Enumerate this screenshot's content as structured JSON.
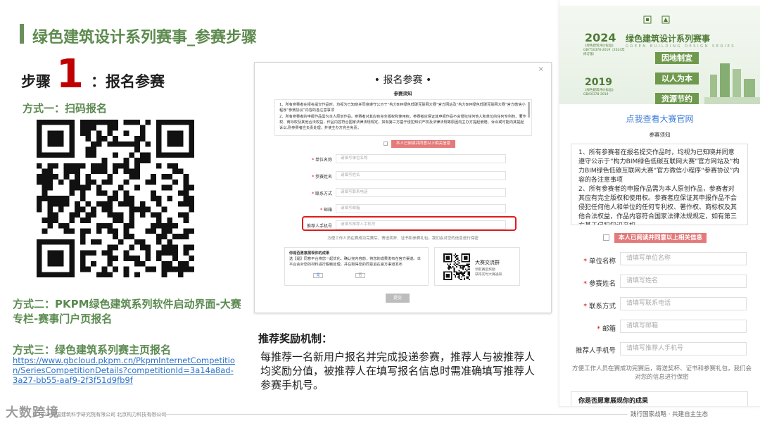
{
  "slide": {
    "title": "绿色建筑设计系列赛事_参赛步骤",
    "step_word": "步骤",
    "step_number": "1",
    "step_label": "：报名参赛",
    "method1": "方式一：扫码报名",
    "method2": "方式二：PKPM绿色建筑系列软件启动界面-大赛专栏-赛事门户页报名",
    "method3": "方式三：绿色建筑系列赛主页报名",
    "method3_link": "https://www.gbcloud.pkpm.cn/PkpmInternetCompetition/SeriesCompetitionDetails?competitionId=3a14a8ad-3a27-bb55-aaf9-2f3f51d9fb9f",
    "reco_title": "推荐奖励机制：",
    "reco_body": "每推荐一名新用户报名并完成投递参赛，推荐人与被推荐人均奖励分值，被推荐人在填写报名信息时需准确填写推荐人参赛手机号。"
  },
  "footer": {
    "logo_text": "大数跨境",
    "copyright": "©2023 中国建筑科学研究院有限公司 北京构力科技有限公司",
    "slogan": "践行国家战略 · 共建自主生态"
  },
  "form": {
    "close": "×",
    "title": "• 报名参赛 •",
    "notice_title": "参赛须知",
    "notice": [
      "1、所有参赛者在报名提交作品时，均视为已知晓并同意遵守公示于“构力BIM绿色低碳互联网大赛”官方网站及“构力BIM绿色低碳互联网大赛”官方微信小程序“参赛协议”内容的各注意事项",
      "2、所有参赛者的申报作品需为本人原创作品。参赛者对其应有完全版权和使用权。参赛者应保证其申报作品不会侵犯任何他人和单位的任何专利权、著作权、商标权及其他合法权益，作品内容符合国家法律法规规定，如有第三方基于侵犯知识产权及法律法规等原因向主办方提起索赔、诉讼或可能向其提起诉讼,则参赛者应负责处理，并使主办方完全免责；"
    ],
    "agree": "本人已阅读并同意以上相关信息",
    "fields": [
      {
        "label": "单位名称",
        "placeholder": "请填写单位名称",
        "required": "*"
      },
      {
        "label": "参赛姓名",
        "placeholder": "请填写姓名",
        "required": "*"
      },
      {
        "label": "联系方式",
        "placeholder": "请填写联系电话",
        "required": "*"
      },
      {
        "label": "邮箱",
        "placeholder": "请填写邮箱",
        "required": "*"
      },
      {
        "label": "推荐人手机号",
        "placeholder": "请填写推荐人手机号",
        "required": ""
      }
    ],
    "tip": "方便工作人员在赛成功完赛后，寄送奖杯、证书和参赛礼包。我们会对您的信息进行保密",
    "willing_title": "你是否愿意展现你的成果",
    "willing_text": "选【是】同意平台将您一起优化、确认完内容前，将您的成果发布在官方渠道。本平台会对您的材料进行脱敏处理，并在取得您的同意后在官方渠道发布",
    "opt_yes": "是",
    "opt_no": "否",
    "group_title": "大赛交流群",
    "group_desc": "领取赛后奖励\n获得实时大赛通知",
    "submit": "提交"
  },
  "phone": {
    "banner_2024": "2024",
    "banner_std1": "《绿色建筑评价标准》GB/T50378-2019（2024年修订版）",
    "banner_title": "绿色建筑设计系列赛事",
    "banner_sub": "GREEN BUILDING DESIGN SERIES",
    "banner_tags": [
      "因地制宜",
      "以人为本",
      "资源节约"
    ],
    "banner_2019": "2019",
    "banner_std2": "《绿色建筑评价标准》GB/50378-2019",
    "link": "点我查看大赛官网",
    "notice_title": "参赛须知",
    "notice": [
      "1、所有参赛者在报名提交作品时，均视为已知晓并同意遵守公示于“构力BIM绿色低碳互联网大赛”官方网站及“构力BIM绿色低碳互联网大赛”官方微信小程序“参赛协议”内容的各注意事项",
      "2、所有参赛者的申报作品需为本人原创作品，参赛者对其应有完全版权和使用权。参赛者应保证其申报作品不会侵犯任何他人和单位的任何专利权、著作权、商标权及其他合法权益，作品内容符合国家法律法规规定，如有第三方基于侵犯知识产权"
    ],
    "agree": "本人已阅读并同意以上相关信息",
    "fields": [
      {
        "label": "单位名称",
        "placeholder": "请填写单位名称",
        "required": "*"
      },
      {
        "label": "参赛姓名",
        "placeholder": "请填写姓名",
        "required": "*"
      },
      {
        "label": "联系方式",
        "placeholder": "请填写联系电话",
        "required": "*"
      },
      {
        "label": "邮箱",
        "placeholder": "请填写邮箱",
        "required": "*"
      },
      {
        "label": "推荐人手机号",
        "placeholder": "请填写推荐人手机号",
        "required": ""
      }
    ],
    "tip": "方便工作人员在赛成功完赛后，寄送奖杯、证书和参赛礼包，我们会对您的信息进行保密",
    "result_title": "你是否愿意展现你的成果"
  },
  "colors": {
    "accent_green": "#5d8a4e",
    "step_red": "#c00000",
    "link_blue": "#2b73c9",
    "highlight_red": "#e11b1b",
    "agree_pink": "#e47a7a"
  }
}
